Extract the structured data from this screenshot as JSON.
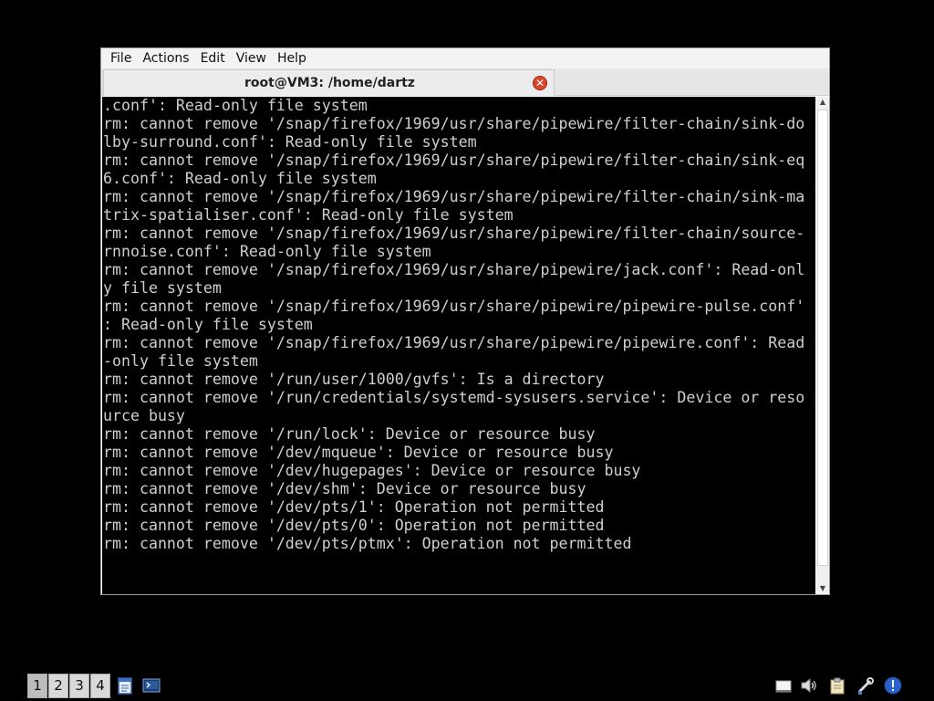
{
  "window": {
    "menu": [
      "File",
      "Actions",
      "Edit",
      "View",
      "Help"
    ],
    "tab_title": "root@VM3: /home/dartz",
    "close_glyph": "✕"
  },
  "terminal": {
    "lines": [
      ".conf': Read-only file system",
      "rm: cannot remove '/snap/firefox/1969/usr/share/pipewire/filter-chain/sink-do",
      "lby-surround.conf': Read-only file system",
      "rm: cannot remove '/snap/firefox/1969/usr/share/pipewire/filter-chain/sink-eq",
      "6.conf': Read-only file system",
      "rm: cannot remove '/snap/firefox/1969/usr/share/pipewire/filter-chain/sink-ma",
      "trix-spatialiser.conf': Read-only file system",
      "rm: cannot remove '/snap/firefox/1969/usr/share/pipewire/filter-chain/source-",
      "rnnoise.conf': Read-only file system",
      "rm: cannot remove '/snap/firefox/1969/usr/share/pipewire/jack.conf': Read-onl",
      "y file system",
      "rm: cannot remove '/snap/firefox/1969/usr/share/pipewire/pipewire-pulse.conf'",
      ": Read-only file system",
      "rm: cannot remove '/snap/firefox/1969/usr/share/pipewire/pipewire.conf': Read",
      "-only file system",
      "rm: cannot remove '/run/user/1000/gvfs': Is a directory",
      "rm: cannot remove '/run/credentials/systemd-sysusers.service': Device or reso",
      "urce busy",
      "rm: cannot remove '/run/lock': Device or resource busy",
      "rm: cannot remove '/dev/mqueue': Device or resource busy",
      "rm: cannot remove '/dev/hugepages': Device or resource busy",
      "rm: cannot remove '/dev/shm': Device or resource busy",
      "rm: cannot remove '/dev/pts/1': Operation not permitted",
      "rm: cannot remove '/dev/pts/0': Operation not permitted",
      "rm: cannot remove '/dev/pts/ptmx': Operation not permitted"
    ]
  },
  "scrollbar": {
    "up_glyph": "▲",
    "down_glyph": "▼"
  },
  "taskbar": {
    "desktops": [
      "1",
      "2",
      "3",
      "4"
    ],
    "active_desktop": "1",
    "launcher_icons": [
      "file-manager-icon",
      "terminal-icon"
    ],
    "tray_icons": [
      "screen-icon",
      "volume-icon",
      "clipboard-icon",
      "network-settings-icon",
      "update-info-icon"
    ]
  },
  "colors": {
    "terminal_bg": "#000000",
    "terminal_fg": "#cfcfcf",
    "close_button": "#d9482b",
    "desktop_bg": "#000000"
  }
}
